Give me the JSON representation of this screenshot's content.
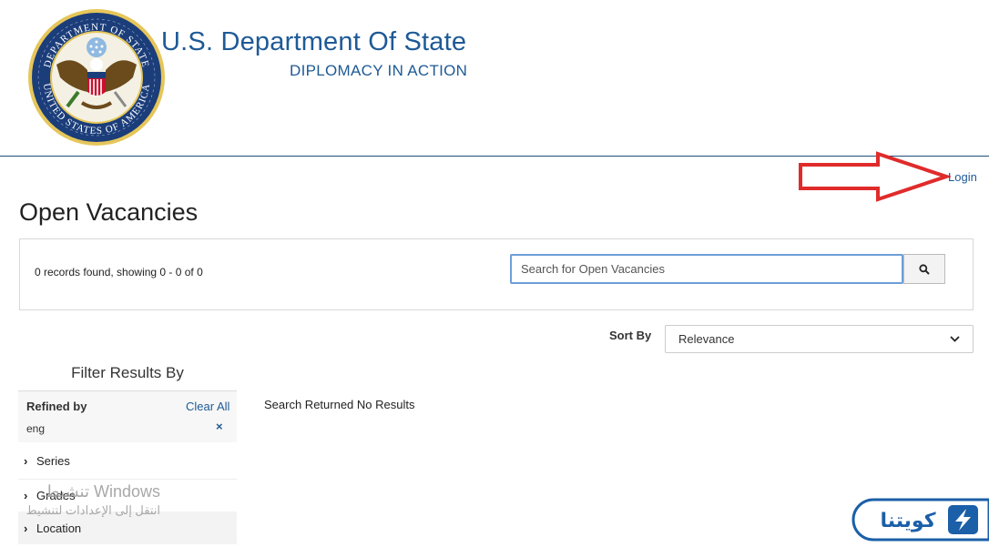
{
  "header": {
    "title": "U.S. Department Of State",
    "subtitle": "DIPLOMACY IN ACTION",
    "seal_text_top": "DEPARTMENT OF STATE",
    "seal_text_bottom": "UNITED STATES OF AMERICA"
  },
  "nav": {
    "login_label": "Login"
  },
  "page": {
    "title": "Open Vacancies"
  },
  "search": {
    "records_text": "0 records found, showing 0 - 0 of 0",
    "placeholder": "Search for Open Vacancies",
    "button_icon": "search-icon"
  },
  "sort": {
    "label": "Sort By",
    "selected": "Relevance"
  },
  "filters": {
    "heading": "Filter Results By",
    "refined_label": "Refined by",
    "clear_all_label": "Clear All",
    "refined_value": "eng",
    "remove_symbol": "×",
    "facets": [
      {
        "label": "Series"
      },
      {
        "label": "Grades"
      },
      {
        "label": "Location"
      }
    ]
  },
  "results": {
    "empty_message": "Search Returned No Results"
  },
  "overlay": {
    "watermark_line1": "تنشيط Windows",
    "watermark_line2": "انتقل إلى الإعدادات لتنشيط",
    "brand_logo_text": "كويتنا",
    "arrow_color": "#e02b2b"
  },
  "colors": {
    "link": "#1e5a96",
    "header_rule": "#1f4e79",
    "focus_border": "#6d9ed8"
  }
}
